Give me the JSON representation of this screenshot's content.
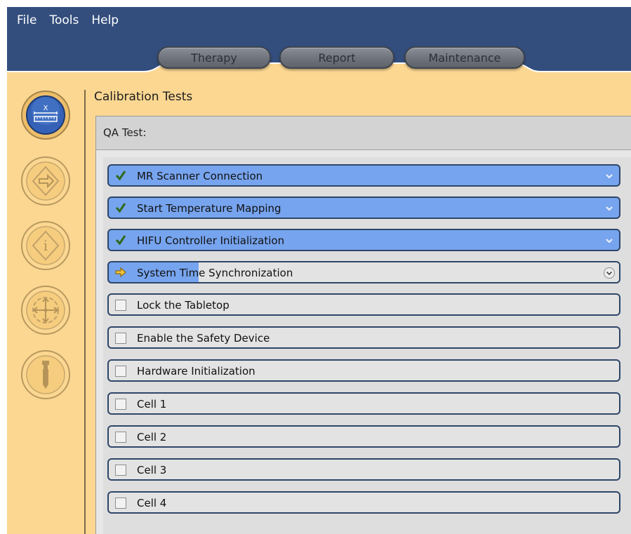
{
  "menu": [
    "File",
    "Tools",
    "Help"
  ],
  "tabs": [
    "Therapy",
    "Report",
    "Maintenance"
  ],
  "sidebar": {
    "buttons": [
      {
        "name": "calibration-ruler-icon",
        "active": true
      },
      {
        "name": "arrow-diamond-icon",
        "active": false
      },
      {
        "name": "info-diamond-icon",
        "active": false
      },
      {
        "name": "move-crosshair-icon",
        "active": false
      },
      {
        "name": "tool-probe-icon",
        "active": false
      }
    ]
  },
  "panel": {
    "title": "Calibration Tests",
    "qa_label": "QA Test:"
  },
  "steps": [
    {
      "label": "MR Scanner Connection",
      "state": "done"
    },
    {
      "label": "Start Temperature Mapping",
      "state": "done"
    },
    {
      "label": "HIFU Controller Initialization",
      "state": "done"
    },
    {
      "label": "System Time Synchronization",
      "state": "active"
    },
    {
      "label": "Lock the Tabletop",
      "state": "pending"
    },
    {
      "label": "Enable the Safety Device",
      "state": "pending"
    },
    {
      "label": "Hardware Initialization",
      "state": "pending"
    },
    {
      "label": "Cell 1",
      "state": "pending"
    },
    {
      "label": "Cell 2",
      "state": "pending"
    },
    {
      "label": "Cell 3",
      "state": "pending"
    },
    {
      "label": "Cell 4",
      "state": "pending"
    }
  ],
  "colors": {
    "topbar": "#334e7d",
    "background": "#fbd792",
    "done_step": "#77a4ee",
    "step_border": "#2e4668",
    "active_blue_button": "#3562b7"
  }
}
